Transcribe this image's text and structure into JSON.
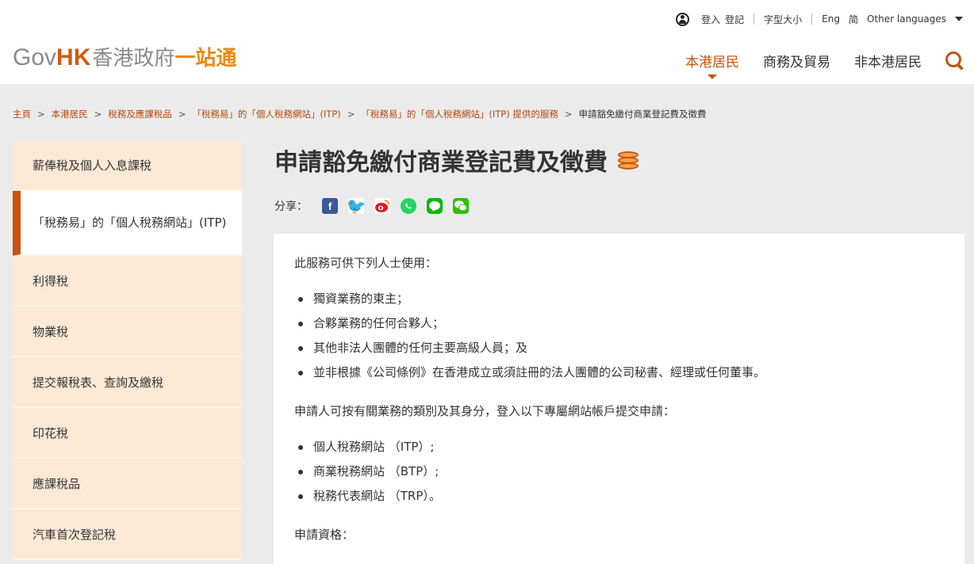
{
  "header": {
    "util": {
      "login": "登入",
      "register": "登記",
      "font_size": "字型大小",
      "eng": "Eng",
      "simplified": "简",
      "other_languages": "Other languages"
    },
    "logo": {
      "gov": "Gov",
      "hk": "HK",
      "cn1": "香港政府",
      "cn2": "一站通"
    },
    "nav": [
      "本港居民",
      "商務及貿易",
      "非本港居民"
    ]
  },
  "breadcrumb": {
    "items": [
      "主頁",
      "本港居民",
      "稅務及應課稅品",
      "「稅務易」的「個人稅務網站」(ITP)",
      "「稅務易」的「個人稅務網站」(ITP) 提供的服務"
    ],
    "current": "申請豁免繳付商業登記費及徵費",
    "separator": ">"
  },
  "sidebar": {
    "items": [
      "薪俸稅及個人入息課稅",
      "「稅務易」的「個人稅務網站」(ITP)",
      "利得稅",
      "物業稅",
      "提交報稅表、查詢及繳稅",
      "印花稅",
      "應課稅品",
      "汽車首次登記稅"
    ]
  },
  "page": {
    "title": "申請豁免繳付商業登記費及徵費",
    "share_label": "分享："
  },
  "content": {
    "intro": "此服務可供下列人士使用：",
    "users": [
      "獨資業務的東主；",
      "合夥業務的任何合夥人；",
      "其他非法人團體的任何主要高級人員；及",
      "並非根據《公司條例》在香港成立或須註冊的法人團體的公司秘書、經理或任何董事。"
    ],
    "apply_text": "申請人可按有關業務的類別及其身分，登入以下專屬網站帳戶提交申請：",
    "portals": [
      "個人稅務網站 （ITP）;",
      "商業稅務網站 （BTP）;",
      "稅務代表網站 （TRP）。"
    ],
    "eligibility": "申請資格："
  }
}
